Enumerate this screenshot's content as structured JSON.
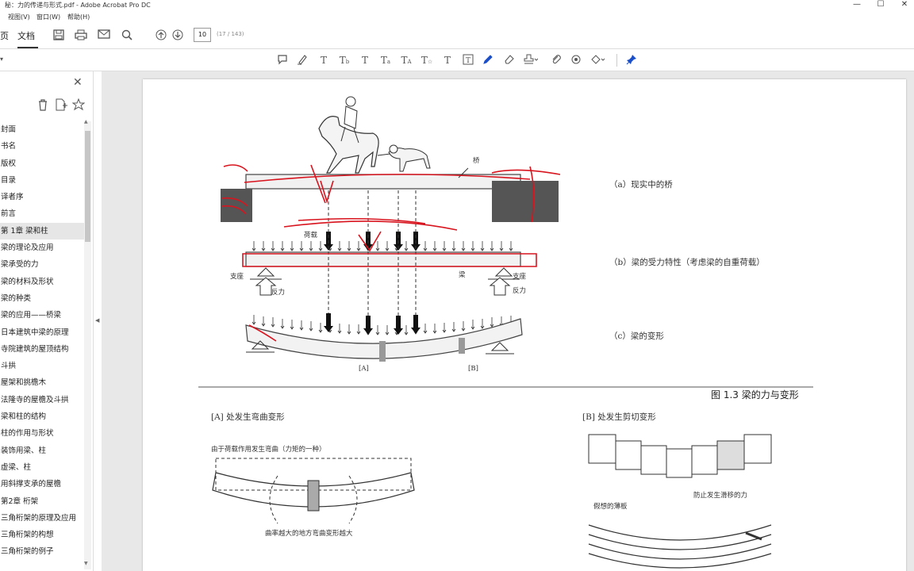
{
  "window": {
    "title": "秘：力的传递与形式.pdf - Adobe Acrobat Pro DC",
    "controls": [
      "—",
      "☐",
      "✕"
    ]
  },
  "menu": {
    "items": [
      "视图(V)",
      "窗口(W)",
      "帮助(H)"
    ]
  },
  "toolbar": {
    "tab_left": "页",
    "tab_doc": "文档",
    "page_number": "10",
    "page_total": "(17 / 143)"
  },
  "sidebar": {
    "bookmarks": [
      "封面",
      "书名",
      "版权",
      "目录",
      "译者序",
      "前言",
      "第 1章  梁和柱",
      "梁的理论及应用",
      "梁承受的力",
      "梁的材料及形状",
      "梁的种类",
      "梁的应用——桥梁",
      "日本建筑中梁的原理",
      "寺院建筑的屋顶结构",
      "斗拱",
      "屋架和挑檐木",
      "法隆寺的屋檐及斗拱",
      "梁和柱的结构",
      "柱的作用与形状",
      "装饰用梁、柱",
      "虚梁、柱",
      "用斜撑支承的屋檐",
      "第2章  桁架",
      "三角桁架的原理及应用",
      "三角桁架的构想",
      "三角桁架的例子"
    ],
    "active_index": 6
  },
  "figure": {
    "captions": {
      "a": "（a）现实中的桥",
      "b": "（b）梁的受力特性（考虑梁的自重荷载）",
      "c": "（c）梁的变形"
    },
    "labels": {
      "bridge": "桥",
      "load": "荷载",
      "beam": "梁",
      "support_left": "支座",
      "reaction_left": "反力",
      "support_right": "支座",
      "reaction_right": "反力",
      "mark_a": "[A]",
      "mark_b": "[B]"
    },
    "title": "图 1.3  梁的力与变形",
    "section_a": {
      "heading": "[A]  处发生弯曲变形",
      "note_top": "由于荷载作用发生弯曲（力矩的一种）",
      "note_bottom": "曲率越大的地方弯曲变形越大"
    },
    "section_b": {
      "heading": "[B]  处发生剪切变形",
      "note_right": "防止发生滑移的力",
      "note_left": "假想的薄板"
    }
  }
}
